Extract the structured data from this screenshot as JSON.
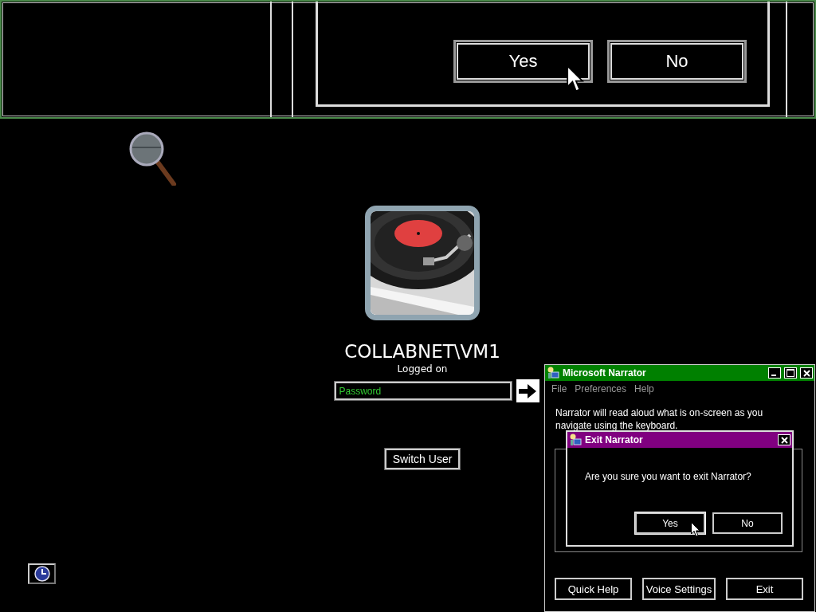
{
  "magnifier": {
    "buttons": [
      "Yes",
      "No"
    ]
  },
  "login": {
    "user_name": "COLLABNET\\VM1",
    "status": "Logged on",
    "password": {
      "placeholder": "Password"
    },
    "switch_user": "Switch User"
  },
  "narrator": {
    "title": "Microsoft Narrator",
    "menu": [
      "File",
      "Preferences",
      "Help"
    ],
    "description": "Narrator will read aloud what is on-screen as you navigate using the keyboard.",
    "buttons": [
      "Quick Help",
      "Voice Settings",
      "Exit"
    ]
  },
  "exit_dialog": {
    "title": "Exit Narrator",
    "message": "Are you sure you want to exit Narrator?",
    "buttons": [
      "Yes",
      "No"
    ]
  }
}
